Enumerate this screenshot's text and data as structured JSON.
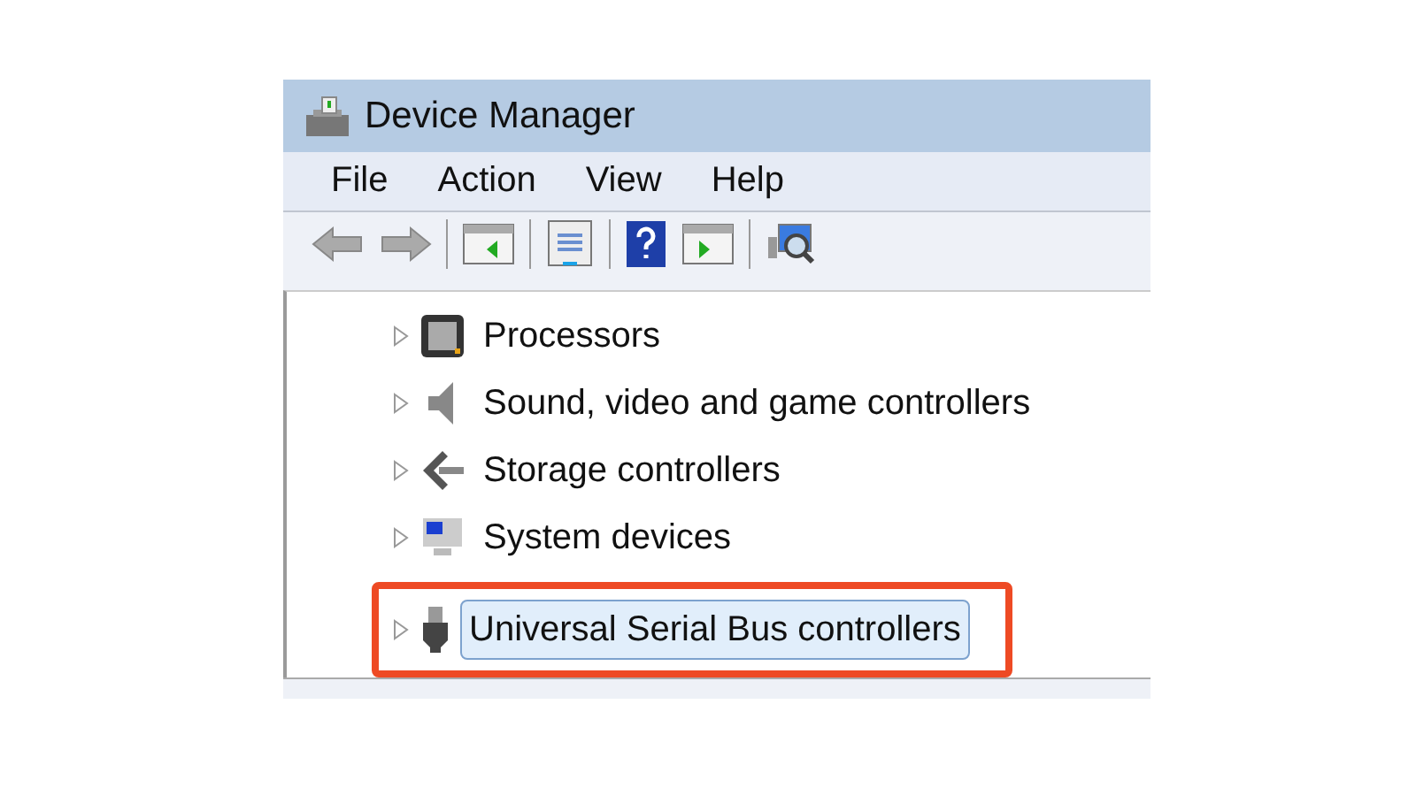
{
  "window": {
    "title": "Device Manager"
  },
  "menu": [
    "File",
    "Action",
    "View",
    "Help"
  ],
  "tree": [
    {
      "label": "Processors",
      "kind": "cpu",
      "selected": false,
      "expanded": false,
      "highlighted": false
    },
    {
      "label": "Sound, video and game controllers",
      "kind": "speaker",
      "selected": false,
      "expanded": false,
      "highlighted": false
    },
    {
      "label": "Storage controllers",
      "kind": "storage",
      "selected": false,
      "expanded": false,
      "highlighted": false
    },
    {
      "label": "System devices",
      "kind": "system",
      "selected": false,
      "expanded": false,
      "highlighted": false
    },
    {
      "label": "Universal Serial Bus controllers",
      "kind": "usb",
      "selected": true,
      "expanded": false,
      "highlighted": true
    }
  ]
}
